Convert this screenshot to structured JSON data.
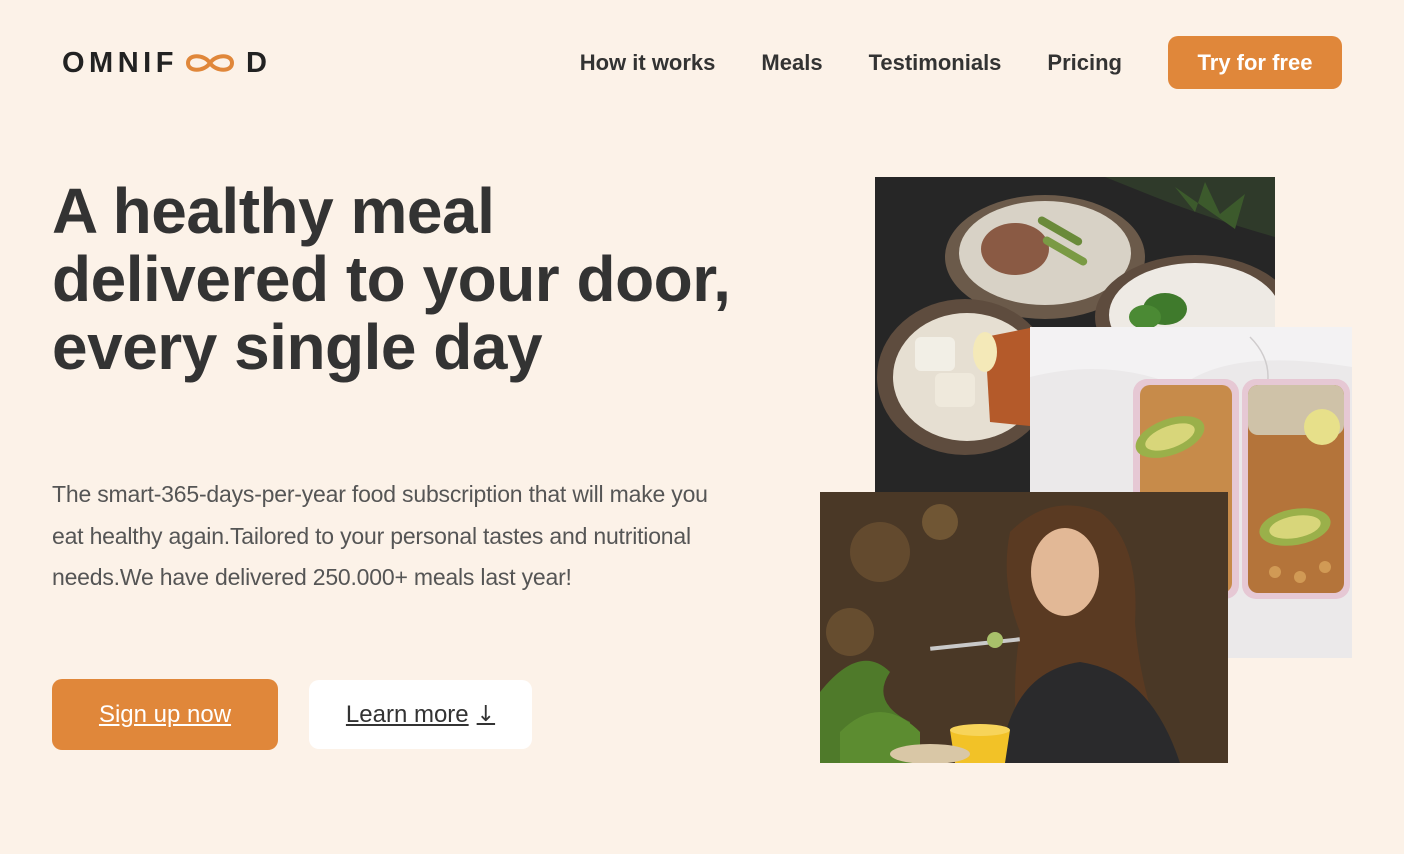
{
  "header": {
    "logo": {
      "left": "OMNIF",
      "right": "D",
      "accent_color": "#e0873a"
    },
    "nav": [
      {
        "label": "How it works"
      },
      {
        "label": "Meals"
      },
      {
        "label": "Testimonials"
      },
      {
        "label": "Pricing"
      }
    ],
    "cta_label": "Try for free"
  },
  "hero": {
    "title": "A healthy meal delivered to your door, every single day",
    "description": "The smart-365-days-per-year food subscription that will make you eat healthy again.Tailored to your personal tastes and nutritional needs.We have delivered 250.000+ meals last year!",
    "primary_button": "Sign up now",
    "secondary_button": "Learn more",
    "secondary_icon": "↓"
  },
  "images": [
    {
      "icon": "meal-bowls-photo"
    },
    {
      "icon": "meal-prep-boxes-photo"
    },
    {
      "icon": "woman-eating-photo"
    }
  ],
  "colors": {
    "background": "#fcf2e8",
    "accent": "#e0873a",
    "text": "#333333"
  }
}
